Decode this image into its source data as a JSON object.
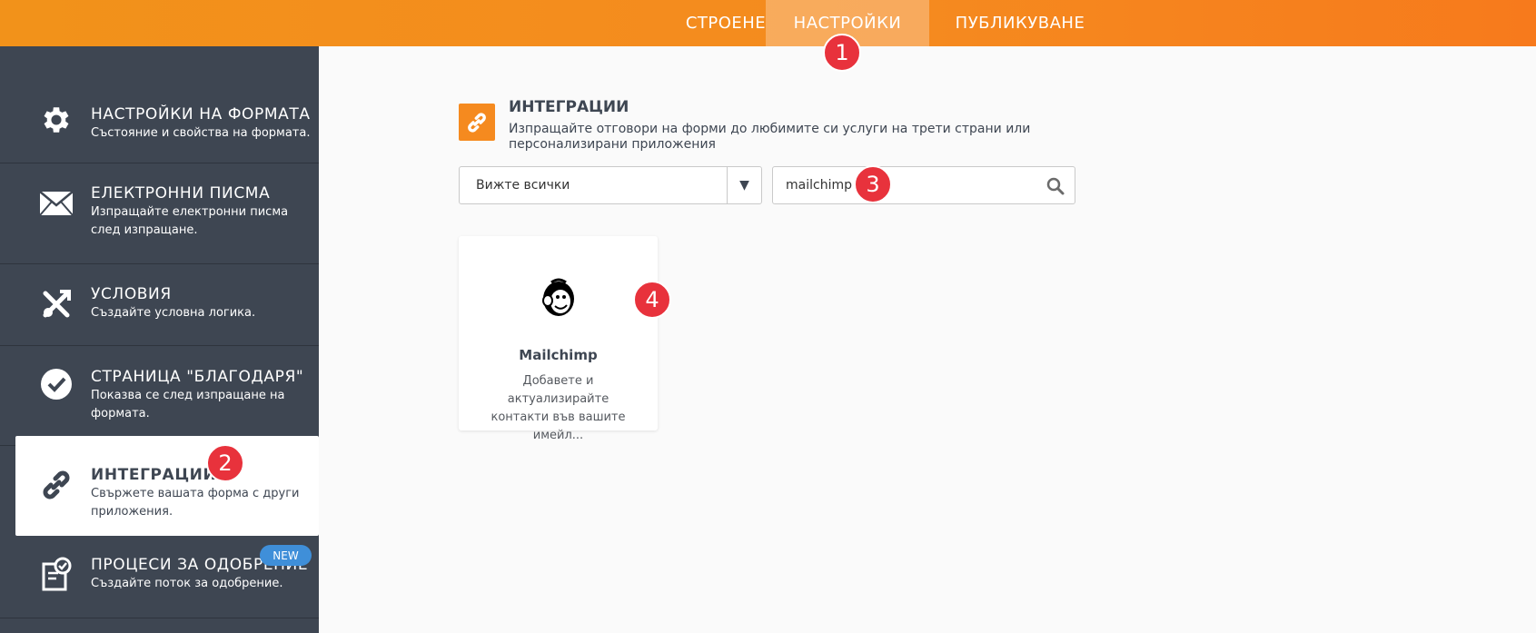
{
  "topnav": {
    "items": [
      {
        "label": "СТРОЕНЕ"
      },
      {
        "label": "НАСТРОЙКИ"
      },
      {
        "label": "ПУБЛИКУВАНЕ"
      }
    ],
    "active": "НАСТРОЙКИ"
  },
  "sidebar": {
    "items": [
      {
        "icon": "gear-icon",
        "title": "НАСТРОЙКИ НА ФОРМАТА",
        "desc": "Състояние и свойства на формата."
      },
      {
        "icon": "envelope-icon",
        "title": "ЕЛЕКТРОННИ ПИСМА",
        "desc": "Изпращайте електронни писма след изпращане."
      },
      {
        "icon": "conditions-icon",
        "title": "УСЛОВИЯ",
        "desc": "Създайте условна логика."
      },
      {
        "icon": "check-circle-icon",
        "title": "СТРАНИЦА \"БЛАГОДАРЯ\"",
        "desc": "Показва се след изпращане на формата."
      },
      {
        "icon": "link-icon",
        "title": "ИНТЕГРАЦИИ",
        "desc": "Свържете вашата форма с други приложения."
      },
      {
        "icon": "approval-icon",
        "title": "ПРОЦЕСИ ЗА ОДОБРЕНИЕ",
        "desc": "Създайте поток за одобрение.",
        "badge": "NEW"
      }
    ],
    "active": "ИНТЕГРАЦИИ"
  },
  "integrations": {
    "title": "ИНТЕГРАЦИИ",
    "desc": "Изпращайте отговори на форми до любимите си услуги на трети страни или персонализирани приложения"
  },
  "filter": {
    "selected": "Вижте всички"
  },
  "search": {
    "value": "mailchimp"
  },
  "card": {
    "title": "Mailchimp",
    "desc": "Добавете и актуализирайте контакти във вашите имейл..."
  },
  "markers": [
    "1",
    "2",
    "3",
    "4"
  ],
  "colors": {
    "accent": "#f58a1f",
    "sidebar": "#3e4652",
    "marker": "#e8323c",
    "badge": "#3f8fd9"
  }
}
